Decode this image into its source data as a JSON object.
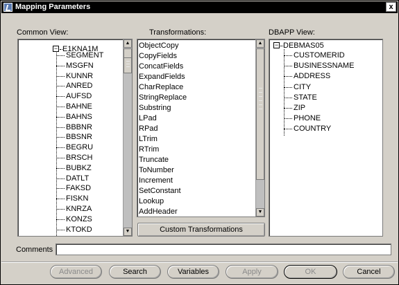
{
  "window": {
    "title": "Mapping Parameters",
    "close_glyph": "x"
  },
  "common_view": {
    "label": "Common View:",
    "root": "E1KNA1M",
    "items": [
      "SEGMENT",
      "MSGFN",
      "KUNNR",
      "ANRED",
      "AUFSD",
      "BAHNE",
      "BAHNS",
      "BBBNR",
      "BBSNR",
      "BEGRU",
      "BRSCH",
      "BUBKZ",
      "DATLT",
      "FAKSD",
      "FISKN",
      "KNRZA",
      "KONZS",
      "KTOKD"
    ]
  },
  "transformations": {
    "label": "Transformations:",
    "items": [
      "ObjectCopy",
      "CopyFields",
      "ConcatFields",
      "ExpandFields",
      "CharReplace",
      "StringReplace",
      "Substring",
      "LPad",
      "RPad",
      "LTrim",
      "RTrim",
      "Truncate",
      "ToNumber",
      "Increment",
      "SetConstant",
      "Lookup",
      "AddHeader"
    ],
    "custom_button": "Custom Transformations"
  },
  "dbapp_view": {
    "label": "DBAPP View:",
    "root": "DEBMAS05",
    "items": [
      "CUSTOMERID",
      "BUSINESSNAME",
      "ADDRESS",
      "CITY",
      "STATE",
      "ZIP",
      "PHONE",
      "COUNTRY"
    ]
  },
  "comments": {
    "label": "Comments",
    "value": ""
  },
  "buttons": {
    "advanced": "Advanced",
    "search": "Search",
    "variables": "Variables",
    "apply": "Apply",
    "ok": "OK",
    "cancel": "Cancel"
  },
  "icons": {
    "toggle_expanded": "minus-box",
    "arrow_up": "▲",
    "arrow_down": "▼"
  }
}
